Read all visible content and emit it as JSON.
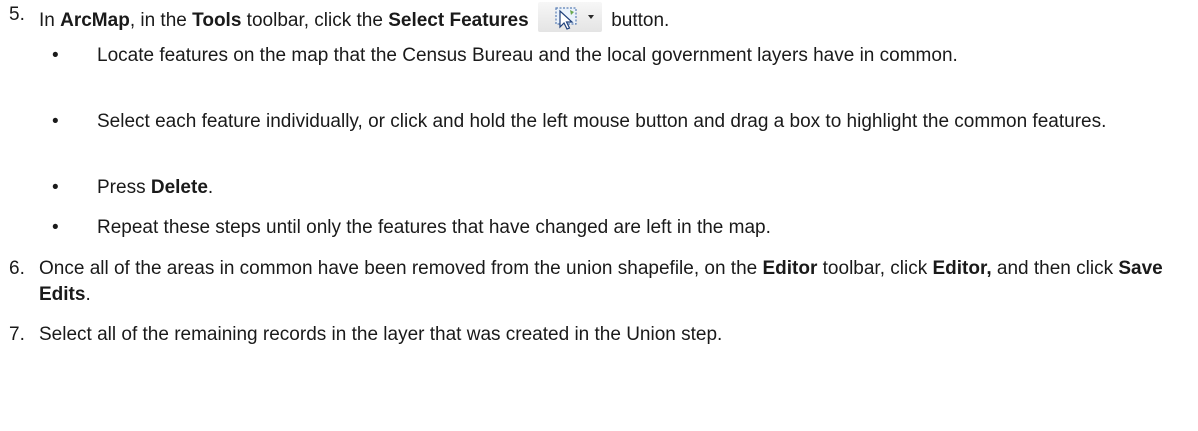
{
  "steps": [
    {
      "number": "5.",
      "parts": [
        "In ",
        "ArcMap",
        ", in the ",
        "Tools",
        " toolbar, click the ",
        "Select Features",
        "button."
      ],
      "bullets": [
        "Locate features on the map that the Census Bureau and the local government layers have in common.",
        "Select each feature individually, or click and hold the left mouse button and drag a box to highlight the common features.",
        {
          "pre": "Press ",
          "bold": "Delete",
          "post": "."
        },
        "Repeat these steps until only the features that have changed are left in the map."
      ]
    },
    {
      "number": "6.",
      "parts": [
        "Once all of the areas in common have been removed from the union shapefile, on the ",
        "Editor",
        " toolbar, click ",
        "Editor,",
        " and then click ",
        "Save Edits",
        "."
      ]
    },
    {
      "number": "7.",
      "text": "Select all of the remaining records in the layer that was created in the Union step."
    }
  ],
  "bullet_char": "•",
  "icons": {
    "select_features": "select-features-icon",
    "dropdown": "dropdown-arrow-icon"
  },
  "colors": {
    "text": "#1a1a1a",
    "icon_arrow": "#3a6fc4",
    "icon_box": "#5a8a3c"
  }
}
